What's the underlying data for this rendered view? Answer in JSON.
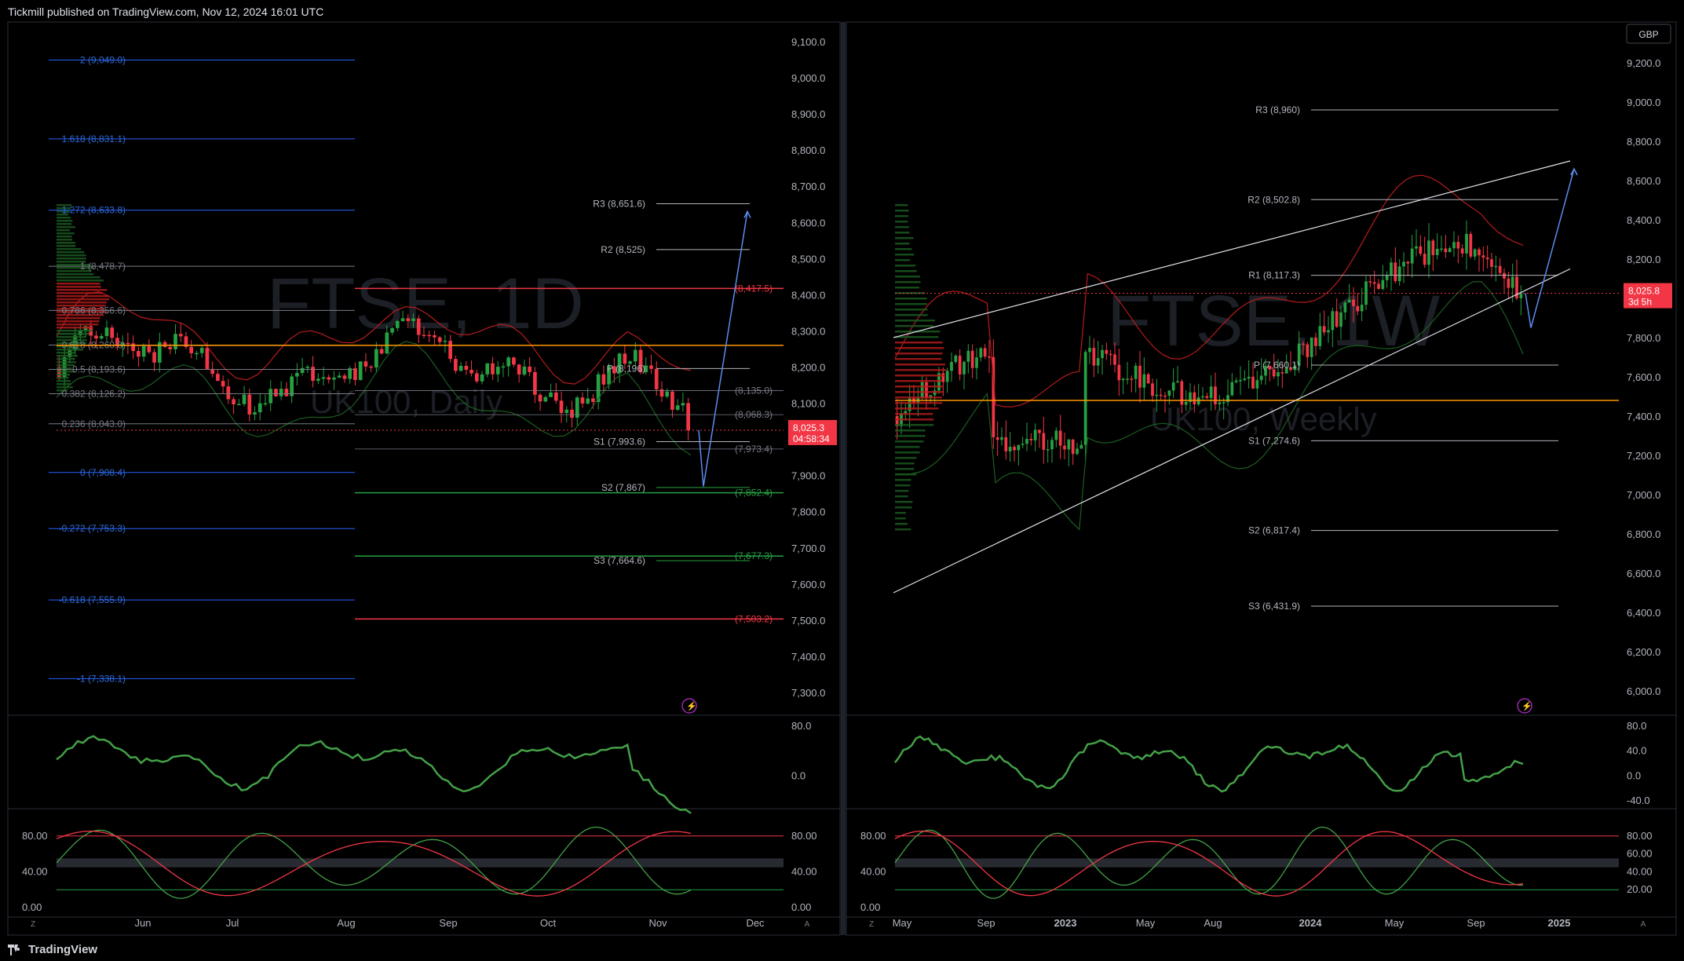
{
  "header": {
    "publisher": "Tickmill published on TradingView.com, Nov 12, 2024 16:01 UTC"
  },
  "footer": {
    "brand": "TradingView"
  },
  "colors": {
    "up": "#26a142",
    "down": "#f23645",
    "fib": "#2962ff",
    "pivot": "#b2b5be",
    "poc": "#ff9800",
    "channel": "#e0e3eb",
    "projection": "#5b8def"
  },
  "icons": [
    "tradingview-logo-icon",
    "lightning-icon",
    "zoom-icon",
    "auto-scale-icon"
  ],
  "chart_data": [
    {
      "type": "candlestick",
      "symbol_watermark": "FTSE, 1D",
      "subtitle_watermark": "UK100, Daily",
      "timeframe": "Daily",
      "ylim": [
        7250,
        9150
      ],
      "price_ticks": [
        "9,100.0",
        "9,000.0",
        "8,900.0",
        "8,800.0",
        "8,700.0",
        "8,600.0",
        "8,500.0",
        "8,400.0",
        "8,300.0",
        "8,200.0",
        "8,100.0",
        "8,000.0",
        "7,900.0",
        "7,800.0",
        "7,700.0",
        "7,600.0",
        "7,500.0",
        "7,400.0",
        "7,300.0"
      ],
      "time_ticks": [
        "Jun",
        "Jul",
        "Aug",
        "Sep",
        "Oct",
        "Nov",
        "Dec"
      ],
      "last_price": "8,025.3",
      "countdown": "04:58:34",
      "fib_levels": [
        {
          "label": "2 (9,049.0)",
          "value": 9049.0
        },
        {
          "label": "1.618 (8,831.1)",
          "value": 8831.1
        },
        {
          "label": "1.272 (8,633.8)",
          "value": 8633.8
        },
        {
          "label": "1 (8,478.7)",
          "value": 8478.7
        },
        {
          "label": "0.786 (8,356.6)",
          "value": 8356.6
        },
        {
          "label": "0.618 (8,260.8)",
          "value": 8260.8
        },
        {
          "label": "0.5 (8,193.6)",
          "value": 8193.6
        },
        {
          "label": "0.382 (8,126.2)",
          "value": 8126.2
        },
        {
          "label": "0.236 (8,043.0)",
          "value": 8043.0
        },
        {
          "label": "0 (7,908.4)",
          "value": 7908.4
        },
        {
          "label": "-0.272 (7,753.3)",
          "value": 7753.3
        },
        {
          "label": "-0.618 (7,555.9)",
          "value": 7555.9
        },
        {
          "label": "-1 (7,338.1)",
          "value": 7338.1
        }
      ],
      "pivot_levels": [
        {
          "label": "R3 (8,651.6)",
          "value": 8651.6
        },
        {
          "label": "R2 (8,525)",
          "value": 8525
        },
        {
          "label": "P (8,196)",
          "value": 8196
        },
        {
          "label": "S1 (7,993.6)",
          "value": 7993.6
        },
        {
          "label": "S2 (7,867)",
          "value": 7867
        },
        {
          "label": "S3 (7,664.6)",
          "value": 7664.6
        }
      ],
      "right_labels": [
        {
          "label": "(8,417.5)",
          "value": 8417.5,
          "color": "#f23645"
        },
        {
          "label": "(8,135.0)",
          "value": 8135.0,
          "color": "#787b86"
        },
        {
          "label": "(8,068.3)",
          "value": 8068.3,
          "color": "#787b86"
        },
        {
          "label": "(7,973.4)",
          "value": 7973.4,
          "color": "#787b86"
        },
        {
          "label": "(7,852.4)",
          "value": 7852.4,
          "color": "#26a142"
        },
        {
          "label": "(7,677.3)",
          "value": 7677.3,
          "color": "#26a142"
        },
        {
          "label": "(7,503.2)",
          "value": 7503.2,
          "color": "#f23645"
        }
      ],
      "projection_target": 8630,
      "osc1_ticks": [
        "80.0",
        "0.0"
      ],
      "osc2_ticks": [
        "80.00",
        "40.00",
        "0.00"
      ],
      "osc2_ticks_right": [
        "80.00",
        "40.00",
        "0.00"
      ]
    },
    {
      "type": "candlestick",
      "symbol_watermark": "FTSE, 1W",
      "subtitle_watermark": "UK100, Weekly",
      "timeframe": "Weekly",
      "currency": "GBP",
      "ylim": [
        5900,
        9400
      ],
      "price_ticks": [
        "9,200.0",
        "9,000.0",
        "8,800.0",
        "8,600.0",
        "8,400.0",
        "8,200.0",
        "8,000.0",
        "7,800.0",
        "7,600.0",
        "7,400.0",
        "7,200.0",
        "7,000.0",
        "6,800.0",
        "6,600.0",
        "6,400.0",
        "6,200.0",
        "6,000.0"
      ],
      "time_ticks": [
        "May",
        "Sep",
        "2023",
        "May",
        "Aug",
        "2024",
        "May",
        "Sep",
        "2025"
      ],
      "last_price": "8,025.8",
      "countdown": "3d 5h",
      "pivot_levels": [
        {
          "label": "R3 (8,960)",
          "value": 8960
        },
        {
          "label": "R2 (8,502.8)",
          "value": 8502.8
        },
        {
          "label": "R1 (8,117.3)",
          "value": 8117.3
        },
        {
          "label": "P (7,660.1)",
          "value": 7660.1
        },
        {
          "label": "S1 (7,274.6)",
          "value": 7274.6
        },
        {
          "label": "S2 (6,817.4)",
          "value": 6817.4
        },
        {
          "label": "S3 (6,431.9)",
          "value": 6431.9
        }
      ],
      "projection_target": 8660,
      "osc1_ticks": [
        "80.0",
        "40.0",
        "0.0",
        "-40.0"
      ],
      "osc2_ticks": [
        "80.00",
        "40.00",
        "0.00"
      ],
      "osc2_ticks_right": [
        "80.00",
        "60.00",
        "40.00",
        "20.00"
      ]
    }
  ]
}
